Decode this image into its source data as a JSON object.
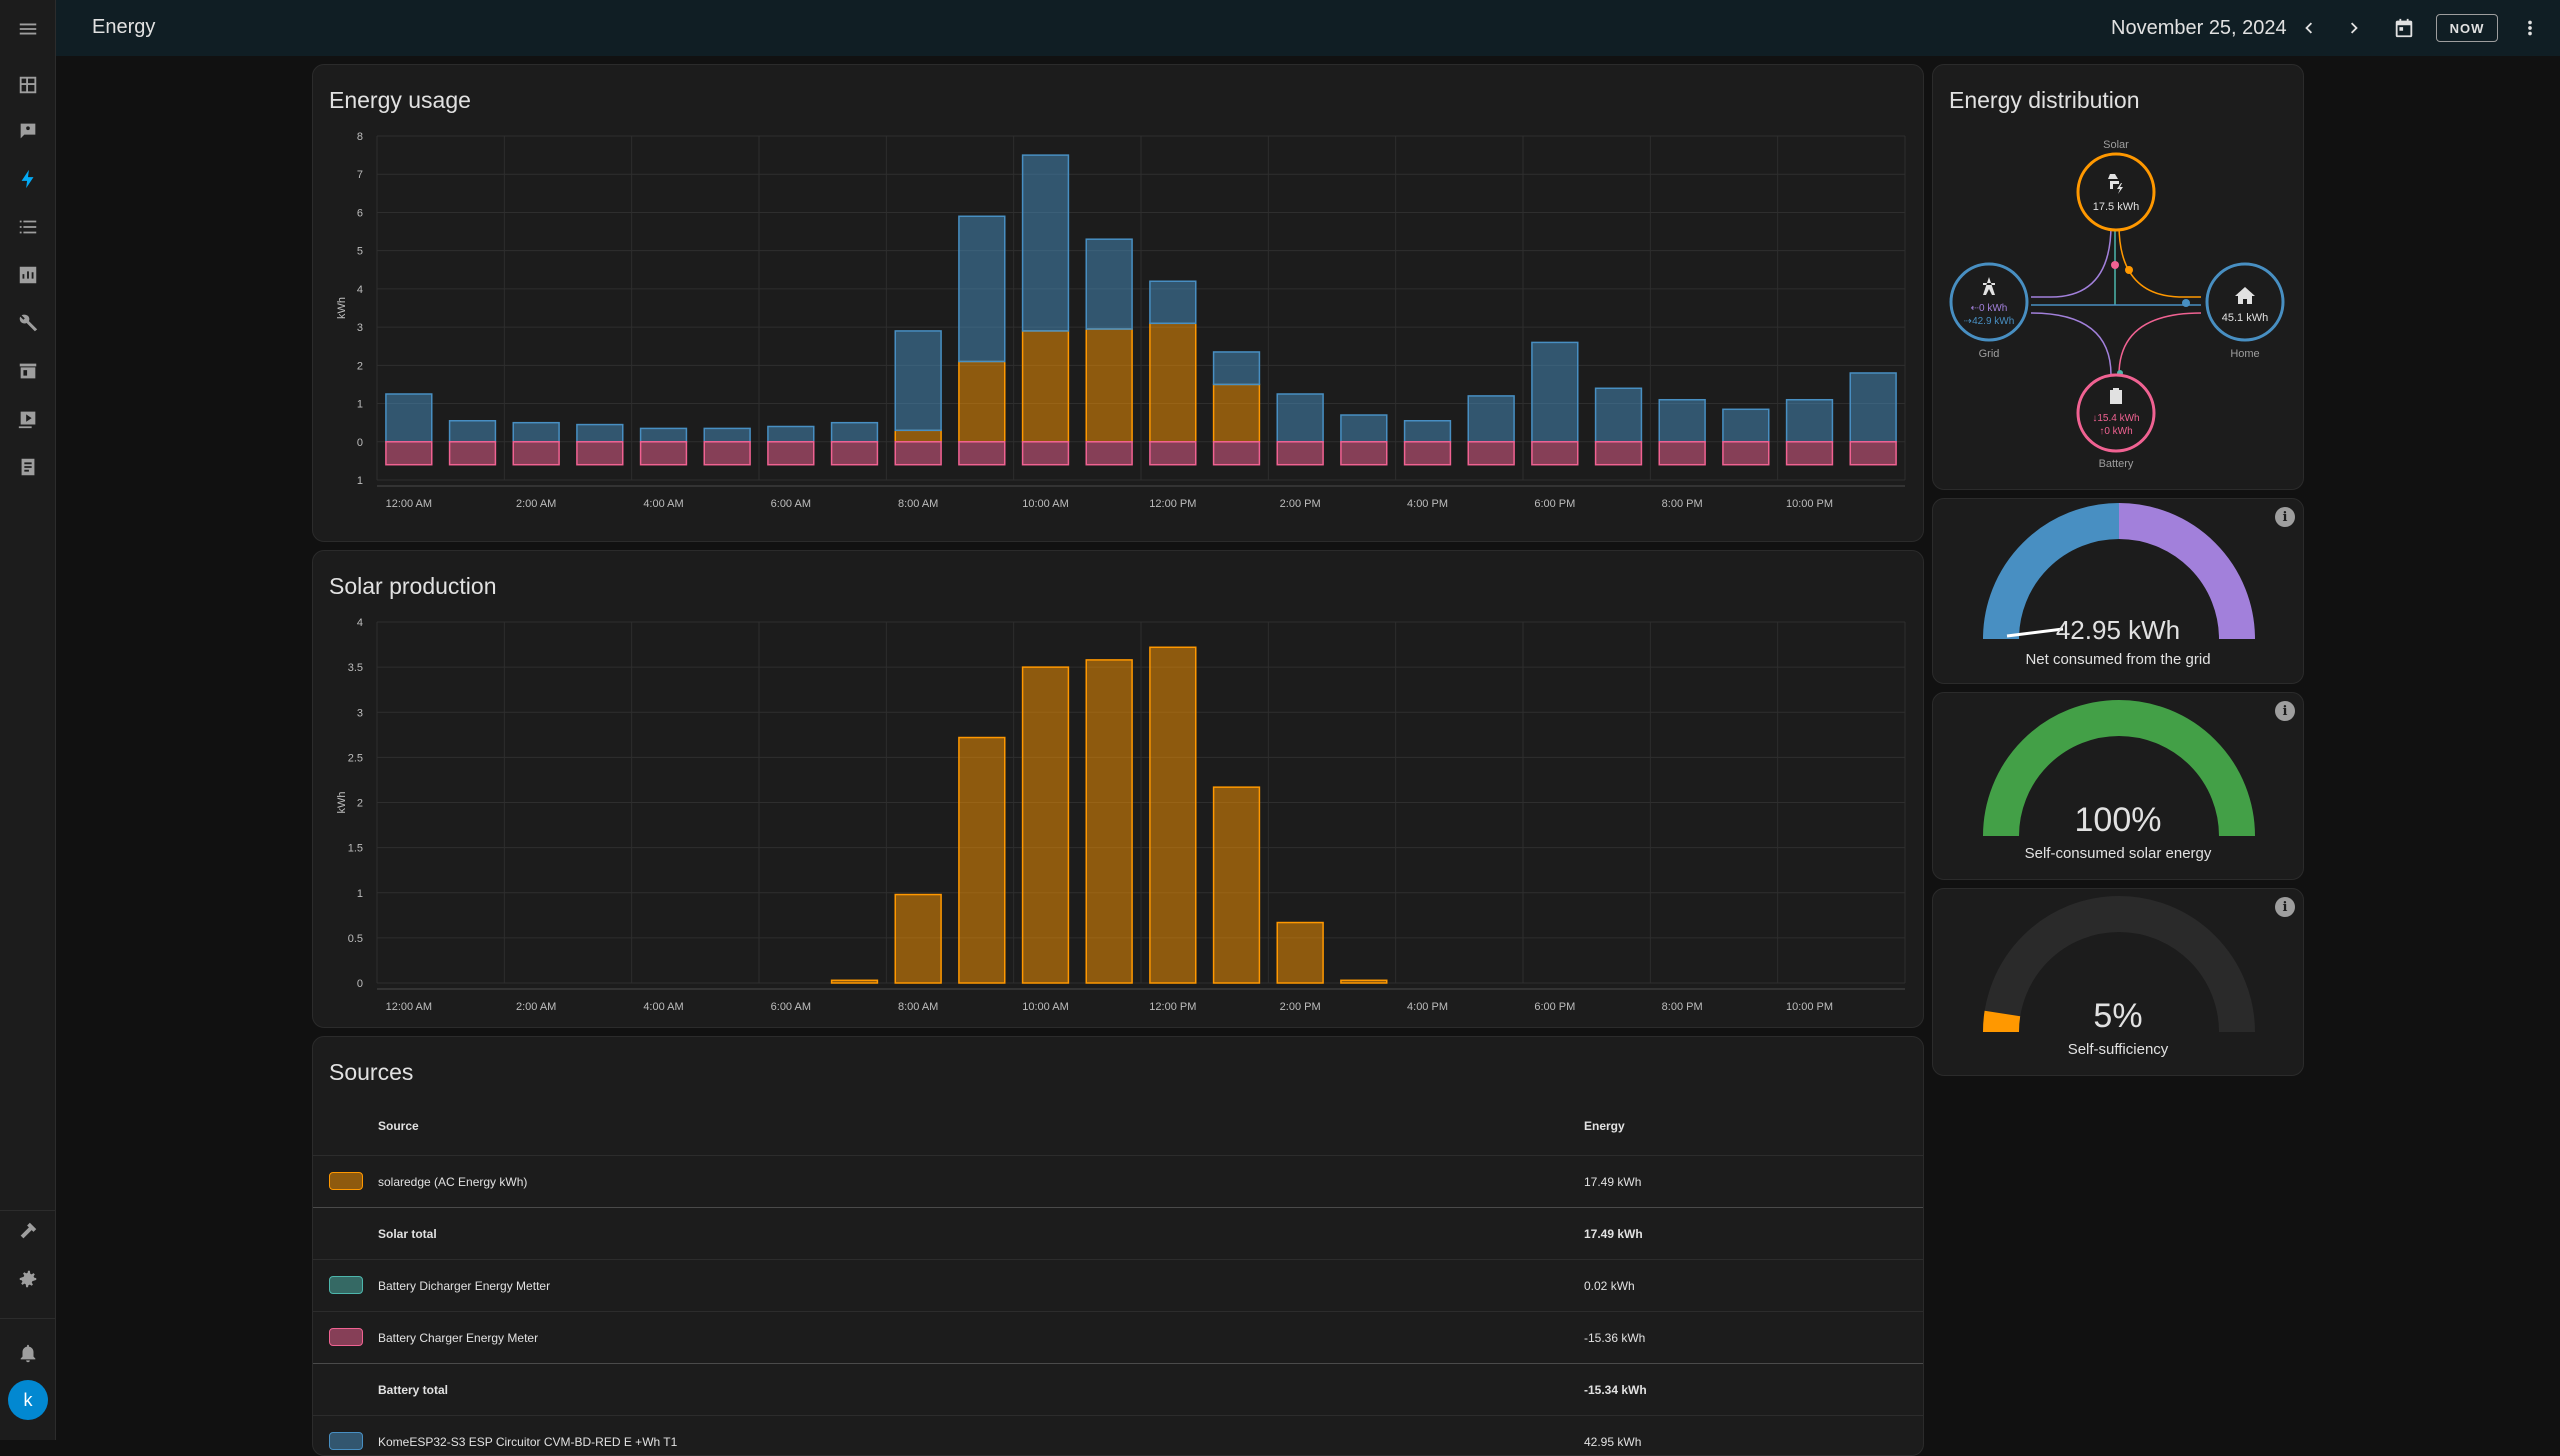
{
  "app": {
    "title": "Energy",
    "date": "November 25, 2024",
    "now_label": "NOW"
  },
  "sidebar": {
    "items": [
      {
        "icon": "overview-icon"
      },
      {
        "icon": "map-icon"
      },
      {
        "icon": "energy-icon",
        "active": true
      },
      {
        "icon": "logbook-icon"
      },
      {
        "icon": "history-icon"
      },
      {
        "icon": "tools-icon"
      },
      {
        "icon": "store-icon"
      },
      {
        "icon": "media-icon"
      },
      {
        "icon": "todo-icon"
      }
    ],
    "bottom": [
      {
        "icon": "developer-tools-icon"
      },
      {
        "icon": "settings-icon"
      },
      {
        "icon": "notifications-icon"
      }
    ],
    "user_initial": "k"
  },
  "energy_usage": {
    "title": "Energy usage",
    "ylabel": "kWh"
  },
  "solar_production": {
    "title": "Solar production",
    "ylabel": "kWh"
  },
  "chart_data": [
    {
      "type": "bar",
      "title": "Energy usage",
      "ylabel": "kWh",
      "ylim": [
        -1,
        8
      ],
      "yticks": [
        "1",
        "0",
        "1",
        "2",
        "3",
        "4",
        "5",
        "6",
        "7",
        "8"
      ],
      "xtick_labels": [
        "12:00 AM",
        "2:00 AM",
        "4:00 AM",
        "6:00 AM",
        "8:00 AM",
        "10:00 AM",
        "12:00 PM",
        "2:00 PM",
        "4:00 PM",
        "6:00 PM",
        "8:00 PM",
        "10:00 PM"
      ],
      "categories": [
        "00",
        "01",
        "02",
        "03",
        "04",
        "05",
        "06",
        "07",
        "08",
        "09",
        "10",
        "11",
        "12",
        "13",
        "14",
        "15",
        "16",
        "17",
        "18",
        "19",
        "20",
        "21",
        "22",
        "23"
      ],
      "series": [
        {
          "name": "Solar",
          "color": "#ff9800",
          "values": [
            0,
            0,
            0,
            0,
            0,
            0,
            0,
            0,
            0.3,
            2.1,
            2.9,
            2.95,
            3.1,
            1.5,
            0,
            0,
            0,
            0,
            0,
            0,
            0,
            0,
            0,
            0
          ]
        },
        {
          "name": "Grid",
          "color": "#488fc2",
          "values": [
            1.25,
            0.55,
            0.5,
            0.45,
            0.35,
            0.35,
            0.4,
            0.5,
            2.6,
            3.8,
            4.6,
            2.35,
            1.1,
            0.85,
            1.25,
            0.7,
            0.55,
            1.2,
            2.6,
            1.4,
            1.1,
            0.85,
            1.1,
            1.8
          ]
        },
        {
          "name": "Battery charge",
          "color": "#f06292",
          "values": [
            -0.6,
            -0.6,
            -0.6,
            -0.6,
            -0.6,
            -0.6,
            -0.6,
            -0.6,
            -0.6,
            -0.6,
            -0.6,
            -0.6,
            -0.6,
            -0.6,
            -0.6,
            -0.6,
            -0.6,
            -0.6,
            -0.6,
            -0.6,
            -0.6,
            -0.6,
            -0.6,
            -0.6
          ]
        }
      ],
      "grid": true
    },
    {
      "type": "bar",
      "title": "Solar production",
      "ylabel": "kWh",
      "ylim": [
        0,
        4
      ],
      "yticks": [
        "0",
        "0.5",
        "1",
        "1.5",
        "2",
        "2.5",
        "3",
        "3.5",
        "4"
      ],
      "xtick_labels": [
        "12:00 AM",
        "2:00 AM",
        "4:00 AM",
        "6:00 AM",
        "8:00 AM",
        "10:00 AM",
        "12:00 PM",
        "2:00 PM",
        "4:00 PM",
        "6:00 PM",
        "8:00 PM",
        "10:00 PM"
      ],
      "categories": [
        "00",
        "01",
        "02",
        "03",
        "04",
        "05",
        "06",
        "07",
        "08",
        "09",
        "10",
        "11",
        "12",
        "13",
        "14",
        "15",
        "16",
        "17",
        "18",
        "19",
        "20",
        "21",
        "22",
        "23"
      ],
      "series": [
        {
          "color": "#ff9800",
          "values": [
            0,
            0,
            0,
            0,
            0,
            0,
            0,
            0.03,
            0.98,
            2.72,
            3.5,
            3.58,
            3.72,
            2.17,
            0.67,
            0.03,
            0,
            0,
            0,
            0,
            0,
            0,
            0,
            0
          ]
        }
      ],
      "grid": true
    }
  ],
  "distribution": {
    "title": "Energy distribution",
    "solar": {
      "label": "Solar",
      "value": "17.5 kWh"
    },
    "grid": {
      "label": "Grid",
      "in": "0 kWh",
      "out": "42.9 kWh"
    },
    "home": {
      "label": "Home",
      "value": "45.1 kWh"
    },
    "battery": {
      "label": "Battery",
      "in": "15.4 kWh",
      "out": "0 kWh"
    }
  },
  "gauges": [
    {
      "value": "42.95 kWh",
      "label": "Net consumed from the grid",
      "fraction": 0.0,
      "colors": [
        "#488fc2",
        "#a280db"
      ]
    },
    {
      "value": "100%",
      "label": "Self-consumed solar energy",
      "fraction": 1.0,
      "color": "#43a047"
    },
    {
      "value": "5%",
      "label": "Self-sufficiency",
      "fraction": 0.05,
      "color": "#ff9800"
    }
  ],
  "sources": {
    "title": "Sources",
    "col_source": "Source",
    "col_energy": "Energy",
    "rows": [
      {
        "name": "solaredge (AC Energy kWh)",
        "energy": "17.49 kWh",
        "color": "#ff9800",
        "total": false
      },
      {
        "name": "Solar total",
        "energy": "17.49 kWh",
        "total": true
      },
      {
        "name": "Battery Dicharger Energy Metter",
        "energy": "0.02 kWh",
        "color": "#4db6ac",
        "total": false
      },
      {
        "name": "Battery Charger Energy Meter",
        "energy": "-15.36 kWh",
        "color": "#f06292",
        "total": false
      },
      {
        "name": "Battery total",
        "energy": "-15.34 kWh",
        "total": true
      },
      {
        "name": "KomeESP32-S3 ESP Circuitor CVM-BD-RED E +Wh T1",
        "energy": "42.95 kWh",
        "color": "#488fc2",
        "total": false
      }
    ]
  }
}
